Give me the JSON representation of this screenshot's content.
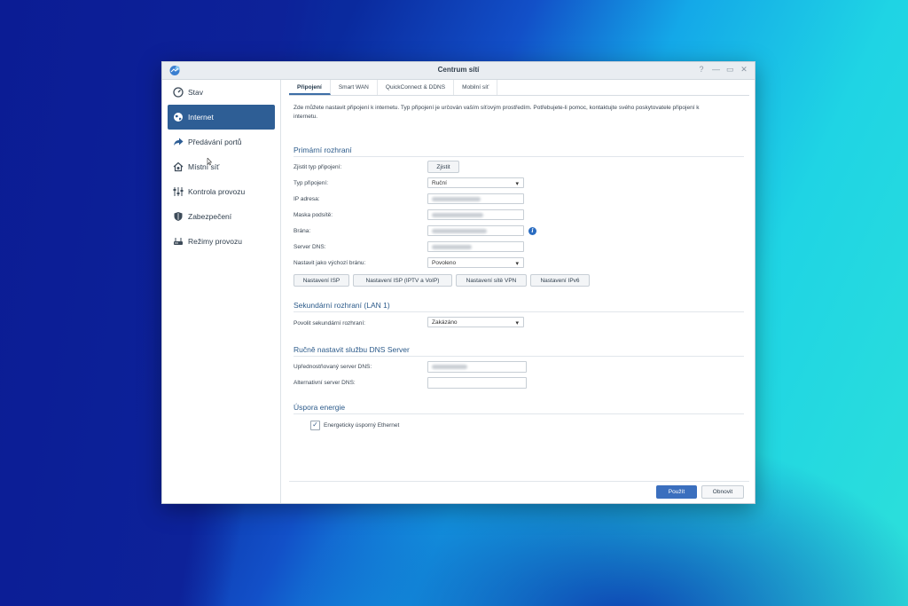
{
  "window": {
    "title": "Centrum sítí",
    "controls": [
      "?",
      "—",
      "▭",
      "✕"
    ]
  },
  "sidebar": {
    "items": [
      {
        "label": "Stav",
        "icon": "gauge-icon",
        "active": false
      },
      {
        "label": "Internet",
        "icon": "globe-icon",
        "active": true
      },
      {
        "label": "Předávání portů",
        "icon": "forward-arrow-icon",
        "active": false
      },
      {
        "label": "Místní síť",
        "icon": "home-network-icon",
        "active": false
      },
      {
        "label": "Kontrola provozu",
        "icon": "sliders-icon",
        "active": false
      },
      {
        "label": "Zabezpečení",
        "icon": "shield-icon",
        "active": false
      },
      {
        "label": "Režimy provozu",
        "icon": "router-icon",
        "active": false
      }
    ]
  },
  "tabs": [
    {
      "label": "Připojení",
      "active": true
    },
    {
      "label": "Smart WAN",
      "active": false
    },
    {
      "label": "QuickConnect & DDNS",
      "active": false
    },
    {
      "label": "Mobilní síť",
      "active": false
    }
  ],
  "description": "Zde můžete nastavit připojení k internetu. Typ připojení je určován vaším síťovým prostředím. Potřebujete-li pomoc, kontaktujte svého poskytovatele připojení k internetu.",
  "primary": {
    "heading": "Primární rozhraní",
    "detect_label": "Zjistit typ připojení:",
    "detect_button": "Zjistit",
    "type_label": "Typ připojení:",
    "type_value": "Ruční",
    "ip_label": "IP adresa:",
    "mask_label": "Maska podsítě:",
    "gateway_label": "Brána:",
    "dns_label": "Server DNS:",
    "default_gw_label": "Nastavit jako výchozí bránu:",
    "default_gw_value": "Povoleno",
    "buttons": [
      "Nastavení ISP",
      "Nastavení ISP (IPTV a VoIP)",
      "Nastavení sítě VPN",
      "Nastavení IPv6"
    ]
  },
  "secondary": {
    "heading": "Sekundární rozhraní (LAN 1)",
    "enable_label": "Povolit sekundární rozhraní:",
    "enable_value": "Zakázáno"
  },
  "dns": {
    "heading": "Ručně nastavit službu DNS Server",
    "preferred_label": "Upřednostňovaný server DNS:",
    "alternate_label": "Alternativní server DNS:"
  },
  "energy": {
    "heading": "Úspora energie",
    "checkbox_label": "Energeticky úsporný Ethernet",
    "checked": true
  },
  "footer": {
    "apply": "Použít",
    "reset": "Obnovit"
  },
  "colors": {
    "accent": "#2e5e95",
    "primary_button": "#3b6fbe",
    "heading": "#2b5a8a"
  }
}
